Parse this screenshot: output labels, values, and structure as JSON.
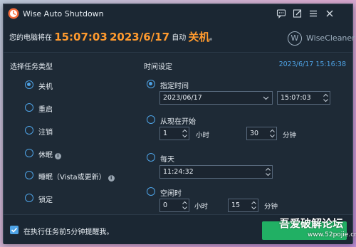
{
  "window": {
    "title": "Wise Auto Shutdown"
  },
  "header": {
    "prefix": "您的电脑将在",
    "time": "15:07:03",
    "date": "2023/6/17",
    "middle": "自动",
    "action": "关机",
    "suffix": "。",
    "brand": "WiseCleaner",
    "brand_mark": "W"
  },
  "task_type": {
    "title": "选择任务类型",
    "options": [
      {
        "label": "关机",
        "selected": true,
        "info": false
      },
      {
        "label": "重启",
        "selected": false,
        "info": false
      },
      {
        "label": "注销",
        "selected": false,
        "info": false
      },
      {
        "label": "休眠",
        "selected": false,
        "info": true
      },
      {
        "label": "睡眠（Vista或更新）",
        "selected": false,
        "info": true
      },
      {
        "label": "锁定",
        "selected": false,
        "info": false
      }
    ]
  },
  "time_settings": {
    "title": "时间设定",
    "now": "2023/6/17 15:16:38",
    "specified": {
      "label": "指定时间",
      "selected": true,
      "date": "2023/06/17",
      "time": "15:07:03"
    },
    "from_now": {
      "label": "从现在开始",
      "selected": false,
      "hours": "1",
      "hours_unit": "小时",
      "minutes": "30",
      "minutes_unit": "分钟"
    },
    "daily": {
      "label": "每天",
      "selected": false,
      "time": "11:24:32"
    },
    "idle": {
      "label": "空闲时",
      "selected": false,
      "hours": "0",
      "hours_unit": "小时",
      "minutes": "15",
      "minutes_unit": "分钟"
    }
  },
  "footer": {
    "remind_label": "在执行任务前5分钟提醒我。",
    "remind_checked": true
  },
  "watermark": {
    "text": "吾爱破解论坛",
    "url": "www.52pojie.cn"
  },
  "colors": {
    "accent": "#4ea3e6",
    "highlight": "#ff9a2e",
    "start_button": "#21b064",
    "background": "#1e2a36"
  },
  "icons": {
    "app": "wise-auto-shutdown-logo",
    "feedback": "chat-icon",
    "edit": "edit-icon",
    "menu": "menu-icon",
    "close": "close-icon"
  }
}
